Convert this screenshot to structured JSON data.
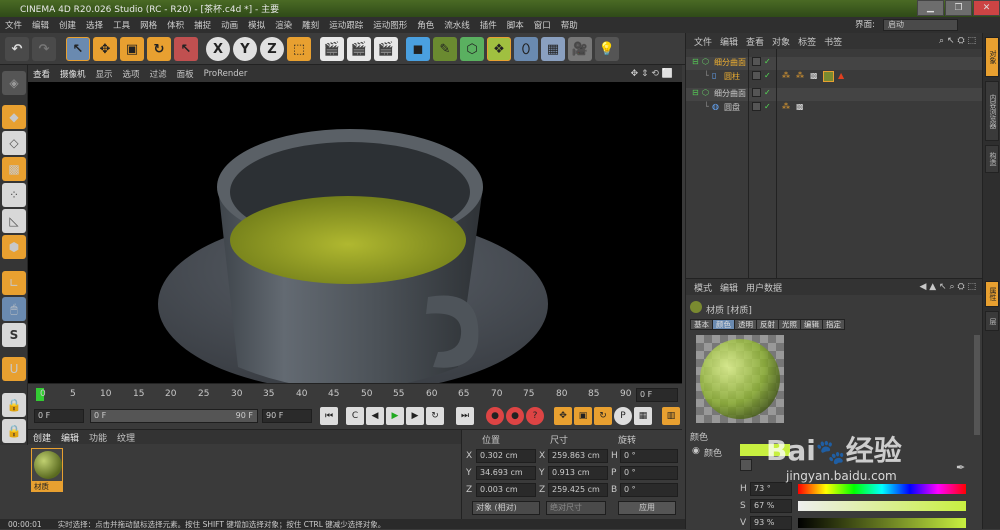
{
  "window": {
    "title": "CINEMA 4D R20.026 Studio (RC - R20) - [茶杯.c4d *] - 主要"
  },
  "menu": [
    "文件",
    "编辑",
    "创建",
    "选择",
    "工具",
    "网格",
    "体积",
    "捕捉",
    "动画",
    "模拟",
    "渲染",
    "雕刻",
    "运动跟踪",
    "运动图形",
    "角色",
    "流水线",
    "插件",
    "脚本",
    "窗口",
    "帮助"
  ],
  "layout": {
    "label": "界面:",
    "value": "启动"
  },
  "toolbar": {
    "x": "X",
    "y": "Y",
    "z": "Z"
  },
  "viewport": {
    "menu": [
      "查看",
      "摄像机",
      "显示",
      "选项",
      "过滤",
      "面板",
      "ProRender"
    ]
  },
  "timeline": {
    "ticks": [
      "0",
      "5",
      "10",
      "15",
      "20",
      "25",
      "30",
      "35",
      "40",
      "45",
      "50",
      "55",
      "60",
      "65",
      "70",
      "75",
      "80",
      "85",
      "90"
    ],
    "frame_field": "0 F"
  },
  "playback": {
    "start": "0 F",
    "slider_start": "0 F",
    "slider_end": "90 F",
    "end": "90 F"
  },
  "materials": {
    "menu": [
      "创建",
      "编辑",
      "功能",
      "纹理"
    ],
    "items": [
      {
        "name": "材质"
      }
    ]
  },
  "coords": {
    "headers": {
      "position": "位置",
      "size": "尺寸",
      "rotation": "旋转"
    },
    "rows": [
      {
        "axis": "X",
        "pos": "0.302 cm",
        "saxis": "X",
        "size": "259.863 cm",
        "raxis": "H",
        "rot": "0 °"
      },
      {
        "axis": "Y",
        "pos": "34.693 cm",
        "saxis": "Y",
        "size": "0.913 cm",
        "raxis": "P",
        "rot": "0 °"
      },
      {
        "axis": "Z",
        "pos": "0.003 cm",
        "saxis": "Z",
        "size": "259.425 cm",
        "raxis": "B",
        "rot": "0 °"
      }
    ],
    "mode": "对象 (相对)",
    "size_mode": "绝对尺寸",
    "apply": "应用"
  },
  "status": {
    "time": "00:00:01",
    "message": "实时选择：点击并拖动鼠标选择元素。按住 SHIFT 键增加选择对象；按住 CTRL 键减少选择对象。"
  },
  "objects": {
    "menu": [
      "文件",
      "编辑",
      "查看",
      "对象",
      "标签",
      "书签"
    ],
    "tree": [
      {
        "name": "细分曲面",
        "level": 0,
        "color": "#f0b030"
      },
      {
        "name": "圆柱",
        "level": 1,
        "color": "#f0b030"
      },
      {
        "name": "细分曲面",
        "level": 0,
        "color": "#e0e0e0"
      },
      {
        "name": "圆盘",
        "level": 1,
        "color": "#e0e0e0"
      }
    ]
  },
  "attributes": {
    "menu": [
      "模式",
      "编辑",
      "用户数据"
    ],
    "title": "材质 [材质]",
    "tabs": [
      "基本",
      "颜色",
      "透明",
      "反射",
      "光照",
      "编辑",
      "指定"
    ],
    "active_tab": "颜色",
    "section": "颜色",
    "color_label": "颜色",
    "color_value": "#c8f040",
    "hsv": [
      {
        "k": "H",
        "v": "73 °"
      },
      {
        "k": "S",
        "v": "67 %"
      },
      {
        "k": "V",
        "v": "93 %"
      }
    ]
  },
  "side_tabs": [
    "对象",
    "内容浏览器",
    "构造",
    "属性",
    "层"
  ],
  "watermark": {
    "brand": "Bai",
    "cn": "经验",
    "url": "jingyan.baidu.com"
  }
}
